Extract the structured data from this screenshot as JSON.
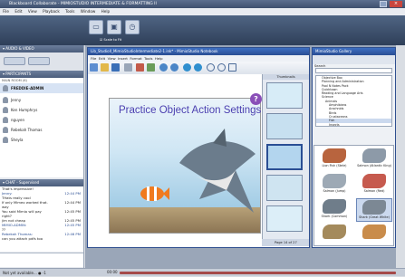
{
  "app": {
    "title": "Blackboard Collaborate - MIMIOSTUDIO INTERMEDIATE & FORMATTING II"
  },
  "menu": [
    "File",
    "Edit",
    "View",
    "Playback",
    "Tools",
    "Window",
    "Help"
  ],
  "toolbar": {
    "scale_label": "Scale to Fit"
  },
  "audio": {
    "header": "AUDIO & VIDEO"
  },
  "participants": {
    "header": "PARTICIPANTS",
    "room": "MAIN ROOM (6)",
    "list": [
      {
        "name": "FREDDIE-ADMIN",
        "role": "Moderator"
      },
      {
        "name": "Jenny"
      },
      {
        "name": "Ken Humphrys"
      },
      {
        "name": "nguyen"
      },
      {
        "name": "Rebekah Thomas"
      },
      {
        "name": "Sheyla"
      }
    ]
  },
  "chat": {
    "header": "CHAT - Supervised",
    "lines": [
      {
        "text": "That's impressive!",
        "time": ""
      },
      {
        "text": "Jenny:",
        "time": "12:44 PM"
      },
      {
        "text": "THats really cool",
        "time": ""
      },
      {
        "text": "If only Mimeo worked that.",
        "time": "12:44 PM"
      },
      {
        "text": "way",
        "time": ""
      },
      {
        "text": "You said Mimio will pay",
        "time": "12:45 PM"
      },
      {
        "text": "right?",
        "time": ""
      },
      {
        "text": "jim not cheap",
        "time": "12:45 PM"
      },
      {
        "text": "MIMIO-ADMIN:",
        "time": "12:45 PM"
      },
      {
        "text": "??",
        "time": ""
      },
      {
        "text": "Rebekah Thomas:",
        "time": "12:46 PM"
      },
      {
        "text": "can you attach pdfs too",
        "time": ""
      }
    ]
  },
  "notebook": {
    "title": "Lib_StudioII_MimioStudioIntermediate2-1.ink* - MimioStudio Notebook",
    "menu": [
      "File",
      "Edit",
      "View",
      "Insert",
      "Format",
      "Tools",
      "Help"
    ],
    "slide_title": "Practice Object Action Settings",
    "page_label": "Page 14 of 27",
    "toolbox_title": "Thumbnails"
  },
  "gallery": {
    "title": "MimioStudio Gallery",
    "search_label": "Search",
    "tree": [
      "Objective Box",
      "Planning and Administration",
      "Pool N Notes Pack",
      "Quicktown",
      "Reading and Language Arts",
      "Science",
      "Animals",
      "Amphibians",
      "Arachnids",
      "Birds",
      "Crustaceans",
      "Fish",
      "Insects"
    ],
    "items": [
      "Lion Fish (Stele)",
      "Salmon (Atlantic King)",
      "Salmon (Jump)",
      "Salmon (Red)",
      "Shark (Common)",
      "Shark (Great White)",
      "",
      ""
    ]
  },
  "status": {
    "connection": "Not yet available... ● -1",
    "time": "00:00"
  }
}
